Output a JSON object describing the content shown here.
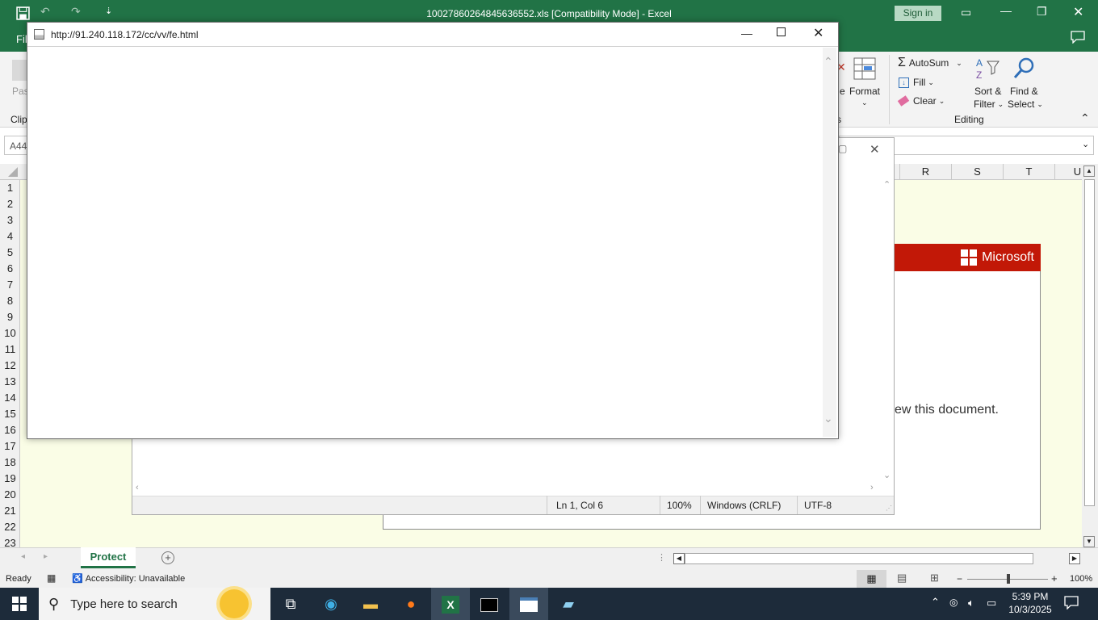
{
  "excel": {
    "title": "10027860264845636552.xls  [Compatibility Mode]  -  Excel",
    "sign_in": "Sign in",
    "file_tab": "Fil",
    "ribbon": {
      "paste_partial": "Pas",
      "clip_partial": "Clip",
      "format_partial_left": "e",
      "format": "Format",
      "autosum": "AutoSum",
      "fill": "Fill",
      "clear": "Clear",
      "sort_filter_l1": "Sort &",
      "sort_filter_l2": "Filter",
      "find_select_l1": "Find &",
      "find_select_l2": "Select",
      "editing_group": "Editing",
      "s_partial": "s"
    },
    "name_box": "A44",
    "columns": [
      "R",
      "S",
      "T",
      "U"
    ],
    "rows": [
      "1",
      "2",
      "3",
      "4",
      "5",
      "6",
      "7",
      "8",
      "9",
      "10",
      "11",
      "12",
      "13",
      "14",
      "15",
      "16",
      "17",
      "18",
      "19",
      "20",
      "21",
      "22",
      "23"
    ],
    "sheet_tab": "Protect",
    "status": {
      "ready": "Ready",
      "accessibility": "Accessibility: Unavailable",
      "zoom": "100%"
    }
  },
  "document_image": {
    "brand": "Microsoft",
    "message_partial": "ew this document."
  },
  "notepad": {
    "status_position": "Ln 1, Col 6",
    "status_zoom": "100%",
    "status_eol": "Windows (CRLF)",
    "status_encoding": "UTF-8"
  },
  "popup": {
    "url": "http://91.240.118.172/cc/vv/fe.html"
  },
  "taskbar": {
    "search_placeholder": "Type here to search",
    "time": "5:39 PM",
    "date": "10/3/2025"
  },
  "colors": {
    "excel_green": "#217346",
    "ms_red": "#c21807",
    "sheet_bg": "#fafde6",
    "taskbar": "#1d2b3a"
  }
}
